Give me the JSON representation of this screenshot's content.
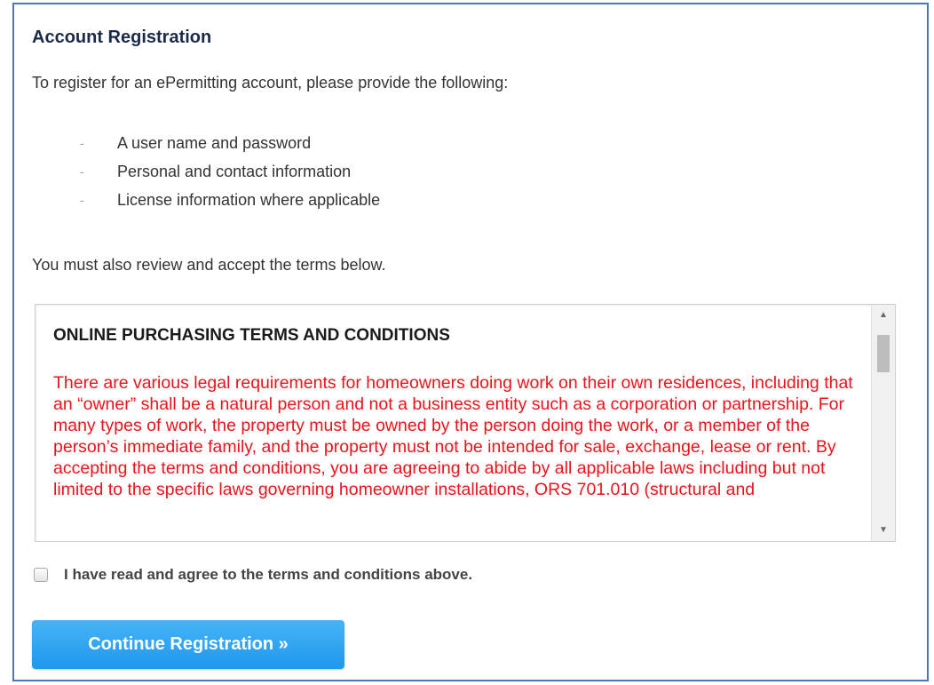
{
  "page": {
    "heading": "Account Registration",
    "intro": "To register for an ePermitting account, please provide the following:",
    "requirements": [
      "A user name and password",
      "Personal and contact information",
      "License information where applicable"
    ],
    "also_note": "You must also review and accept the terms below."
  },
  "terms": {
    "title": "ONLINE PURCHASING TERMS AND CONDITIONS",
    "body": "There are various legal requirements for homeowners doing work on their own residences, including that an “owner” shall be a natural person and not a business entity such as a corporation or partnership. For many types of work, the property must be owned by the person doing the work, or a member of the person’s immediate family, and the property must not be intended for sale, exchange, lease or rent. By accepting the terms and conditions, you are agreeing to abide by all applicable laws including but not limited to the specific laws governing homeowner installations, ORS 701.010 (structural and"
  },
  "agreement": {
    "label": "I have read and agree to the terms and conditions above.",
    "checked": false
  },
  "actions": {
    "continue_label": "Continue Registration »"
  },
  "colors": {
    "frame_border": "#4a78b8",
    "terms_text": "#e8141c",
    "button": "#1f97ec"
  }
}
